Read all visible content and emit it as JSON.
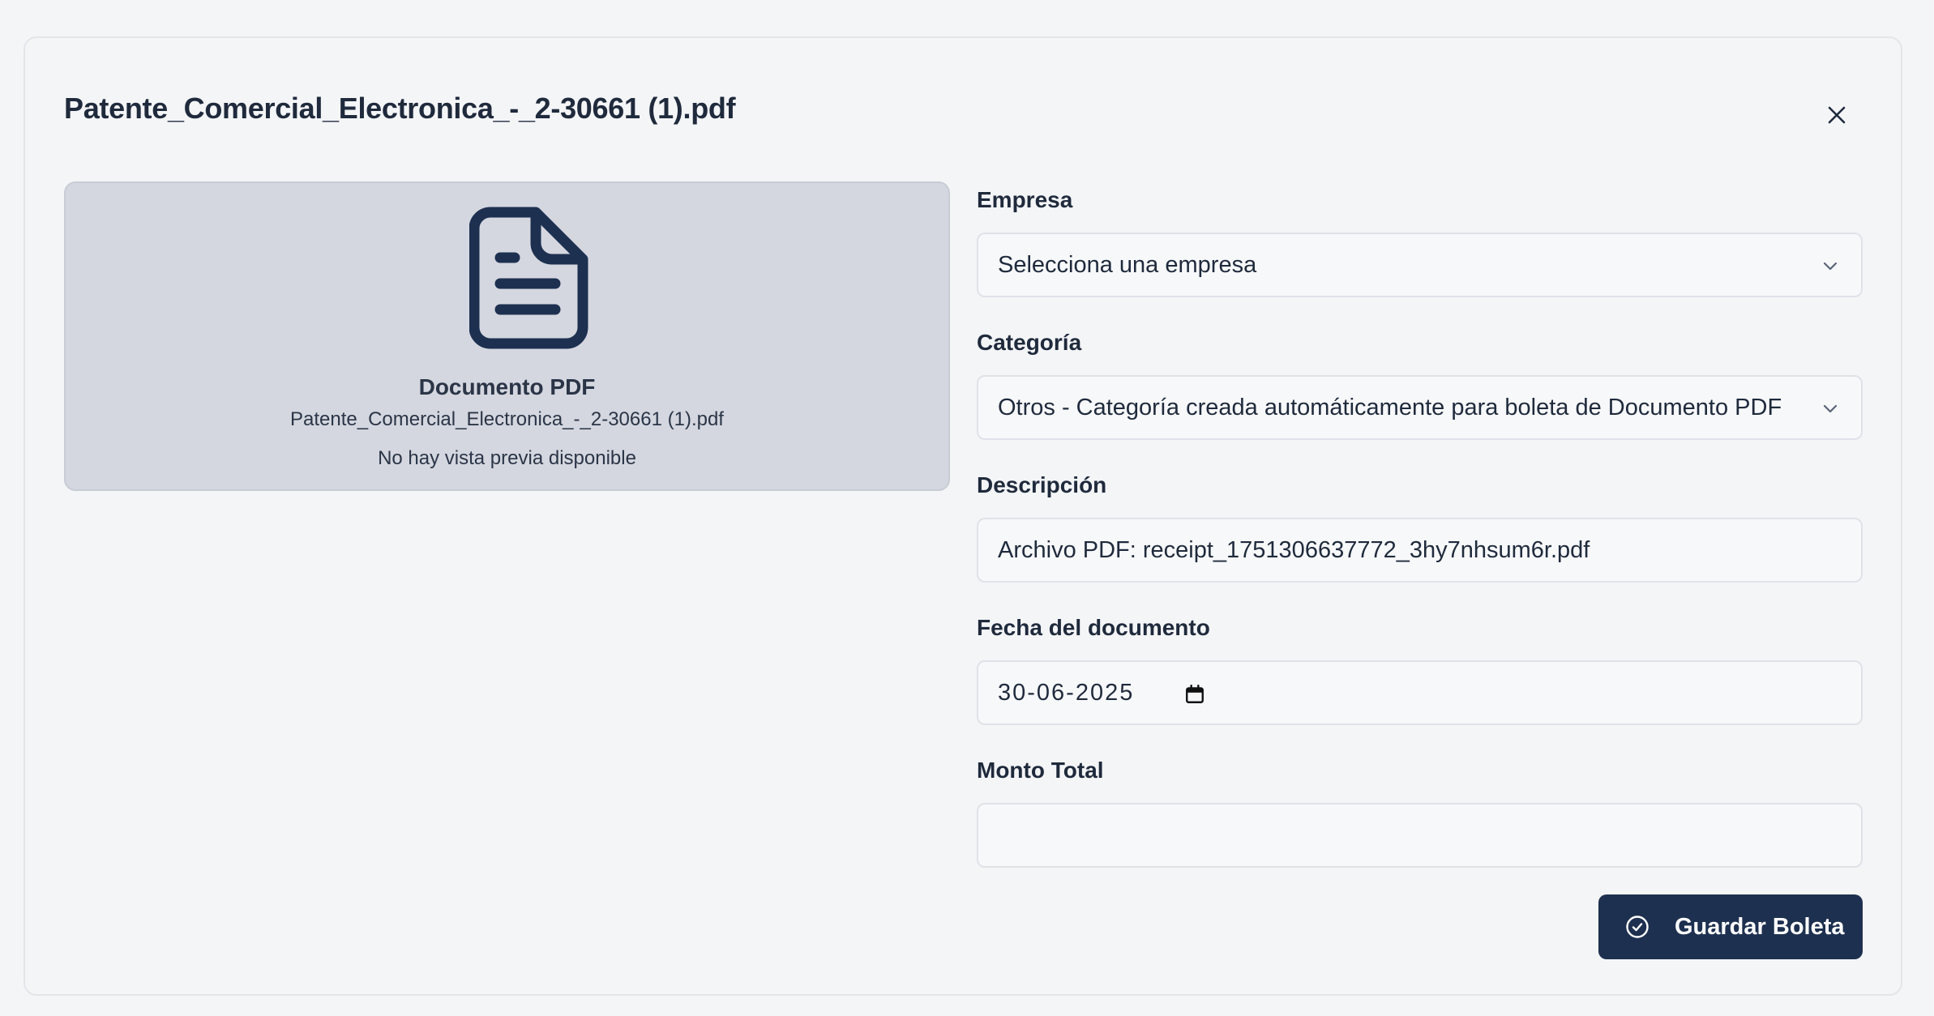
{
  "modal": {
    "title": "Patente_Comercial_Electronica_-_2-30661 (1).pdf",
    "close_icon": "close-icon"
  },
  "preview": {
    "icon": "file-document-icon",
    "heading": "Documento PDF",
    "filename": "Patente_Comercial_Electronica_-_2-30661 (1).pdf",
    "note": "No hay vista previa disponible"
  },
  "form": {
    "empresa": {
      "label": "Empresa",
      "value": "Selecciona una empresa"
    },
    "categoria": {
      "label": "Categoría",
      "value": "Otros - Categoría creada automáticamente para boleta de Documento PDF"
    },
    "descripcion": {
      "label": "Descripción",
      "value": "Archivo PDF: receipt_1751306637772_3hy7nhsum6r.pdf"
    },
    "fecha": {
      "label": "Fecha del documento",
      "value": "30-06-2025"
    },
    "monto": {
      "label": "Monto Total",
      "value": ""
    }
  },
  "actions": {
    "save_label": "Guardar Boleta"
  },
  "colors": {
    "primary": "#1e3050",
    "background": "#f4f5f7",
    "preview_bg": "#d4d7df",
    "text": "#1f2a3c"
  }
}
